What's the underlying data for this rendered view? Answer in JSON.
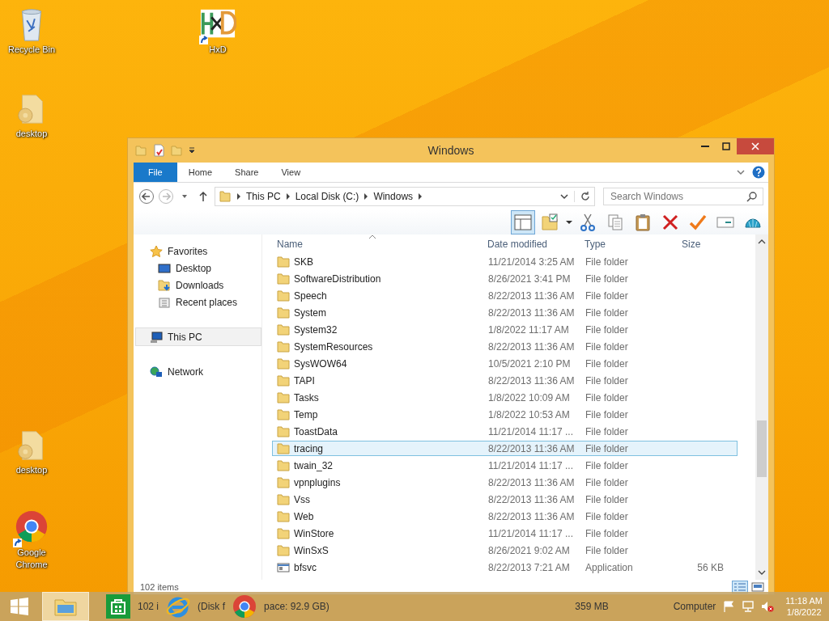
{
  "desktop_icons": [
    {
      "label": "Recycle Bin",
      "kind": "recycle",
      "shortcut": false
    },
    {
      "label": "HxD",
      "kind": "hxd",
      "shortcut": true
    },
    {
      "label": "desktop",
      "kind": "settings-file",
      "shortcut": false
    },
    {
      "label": "desktop",
      "kind": "settings-file",
      "shortcut": false
    },
    {
      "label": "Google Chrome",
      "kind": "chrome",
      "shortcut": true
    }
  ],
  "window": {
    "title": "Windows",
    "ribbon_tabs": [
      {
        "label": "File",
        "kind": "file",
        "selected": false
      },
      {
        "label": "Home",
        "kind": "tab",
        "selected": false
      },
      {
        "label": "Share",
        "kind": "tab",
        "selected": false
      },
      {
        "label": "View",
        "kind": "tab",
        "selected": false
      }
    ],
    "address": {
      "crumbs": [
        "This PC",
        "Local Disk (C:)",
        "Windows"
      ]
    },
    "search": {
      "placeholder": "Search Windows"
    },
    "layout_button": {
      "pressed": true
    },
    "toolbar": [
      {
        "kind": "folder-check"
      },
      {
        "kind": "cut"
      },
      {
        "kind": "copy"
      },
      {
        "kind": "paste"
      },
      {
        "kind": "delete"
      },
      {
        "kind": "check"
      },
      {
        "kind": "rename"
      },
      {
        "kind": "shell"
      }
    ],
    "sidebar": [
      {
        "label": "Favorites",
        "kind": "star",
        "selected": false,
        "children": [
          {
            "label": "Desktop",
            "kind": "desktop",
            "selected": false
          },
          {
            "label": "Downloads",
            "kind": "downloads",
            "selected": false
          },
          {
            "label": "Recent places",
            "kind": "recent",
            "selected": false
          }
        ]
      },
      {
        "label": "This PC",
        "kind": "pc",
        "selected": true
      },
      {
        "label": "Network",
        "kind": "network",
        "selected": false
      }
    ],
    "columns": [
      "Name",
      "Date modified",
      "Type",
      "Size"
    ],
    "rows": [
      {
        "name": "SKB",
        "date": "11/21/2014 3:25 AM",
        "type": "File folder",
        "kind": "folder",
        "selected": false
      },
      {
        "name": "SoftwareDistribution",
        "date": "8/26/2021 3:41 PM",
        "type": "File folder",
        "kind": "folder",
        "selected": false
      },
      {
        "name": "Speech",
        "date": "8/22/2013 11:36 AM",
        "type": "File folder",
        "kind": "folder",
        "selected": false
      },
      {
        "name": "System",
        "date": "8/22/2013 11:36 AM",
        "type": "File folder",
        "kind": "folder",
        "selected": false
      },
      {
        "name": "System32",
        "date": "1/8/2022 11:17 AM",
        "type": "File folder",
        "kind": "folder",
        "selected": false
      },
      {
        "name": "SystemResources",
        "date": "8/22/2013 11:36 AM",
        "type": "File folder",
        "kind": "folder",
        "selected": false
      },
      {
        "name": "SysWOW64",
        "date": "10/5/2021 2:10 PM",
        "type": "File folder",
        "kind": "folder",
        "selected": false
      },
      {
        "name": "TAPI",
        "date": "8/22/2013 11:36 AM",
        "type": "File folder",
        "kind": "folder",
        "selected": false
      },
      {
        "name": "Tasks",
        "date": "1/8/2022 10:09 AM",
        "type": "File folder",
        "kind": "folder",
        "selected": false
      },
      {
        "name": "Temp",
        "date": "1/8/2022 10:53 AM",
        "type": "File folder",
        "kind": "folder",
        "selected": false
      },
      {
        "name": "ToastData",
        "date": "11/21/2014 11:17 ...",
        "type": "File folder",
        "kind": "folder",
        "selected": false
      },
      {
        "name": "tracing",
        "date": "8/22/2013 11:36 AM",
        "type": "File folder",
        "kind": "folder",
        "selected": true
      },
      {
        "name": "twain_32",
        "date": "11/21/2014 11:17 ...",
        "type": "File folder",
        "kind": "folder",
        "selected": false
      },
      {
        "name": "vpnplugins",
        "date": "8/22/2013 11:36 AM",
        "type": "File folder",
        "kind": "folder",
        "selected": false
      },
      {
        "name": "Vss",
        "date": "8/22/2013 11:36 AM",
        "type": "File folder",
        "kind": "folder",
        "selected": false
      },
      {
        "name": "Web",
        "date": "8/22/2013 11:36 AM",
        "type": "File folder",
        "kind": "folder",
        "selected": false
      },
      {
        "name": "WinStore",
        "date": "11/21/2014 11:17 ...",
        "type": "File folder",
        "kind": "folder",
        "selected": false
      },
      {
        "name": "WinSxS",
        "date": "8/26/2021 9:02 AM",
        "type": "File folder",
        "kind": "folder",
        "selected": false
      },
      {
        "name": "bfsvc",
        "date": "8/22/2013 7:21 AM",
        "type": "Application",
        "size": "56 KB",
        "kind": "app",
        "selected": false
      }
    ],
    "status_bar": {
      "items": "102 items"
    }
  },
  "taskbar": {
    "apps": [
      {
        "kind": "explorer",
        "active": true
      },
      {
        "kind": "store",
        "active": false
      },
      {
        "kind": "ie",
        "active": false
      },
      {
        "kind": "chrome",
        "active": false
      }
    ],
    "behind_texts": [
      "102 i",
      "(Disk f",
      "pace: 92.9 GB)",
      "359 MB",
      "Computer"
    ],
    "time": "11:18 AM",
    "date": "1/8/2022"
  }
}
